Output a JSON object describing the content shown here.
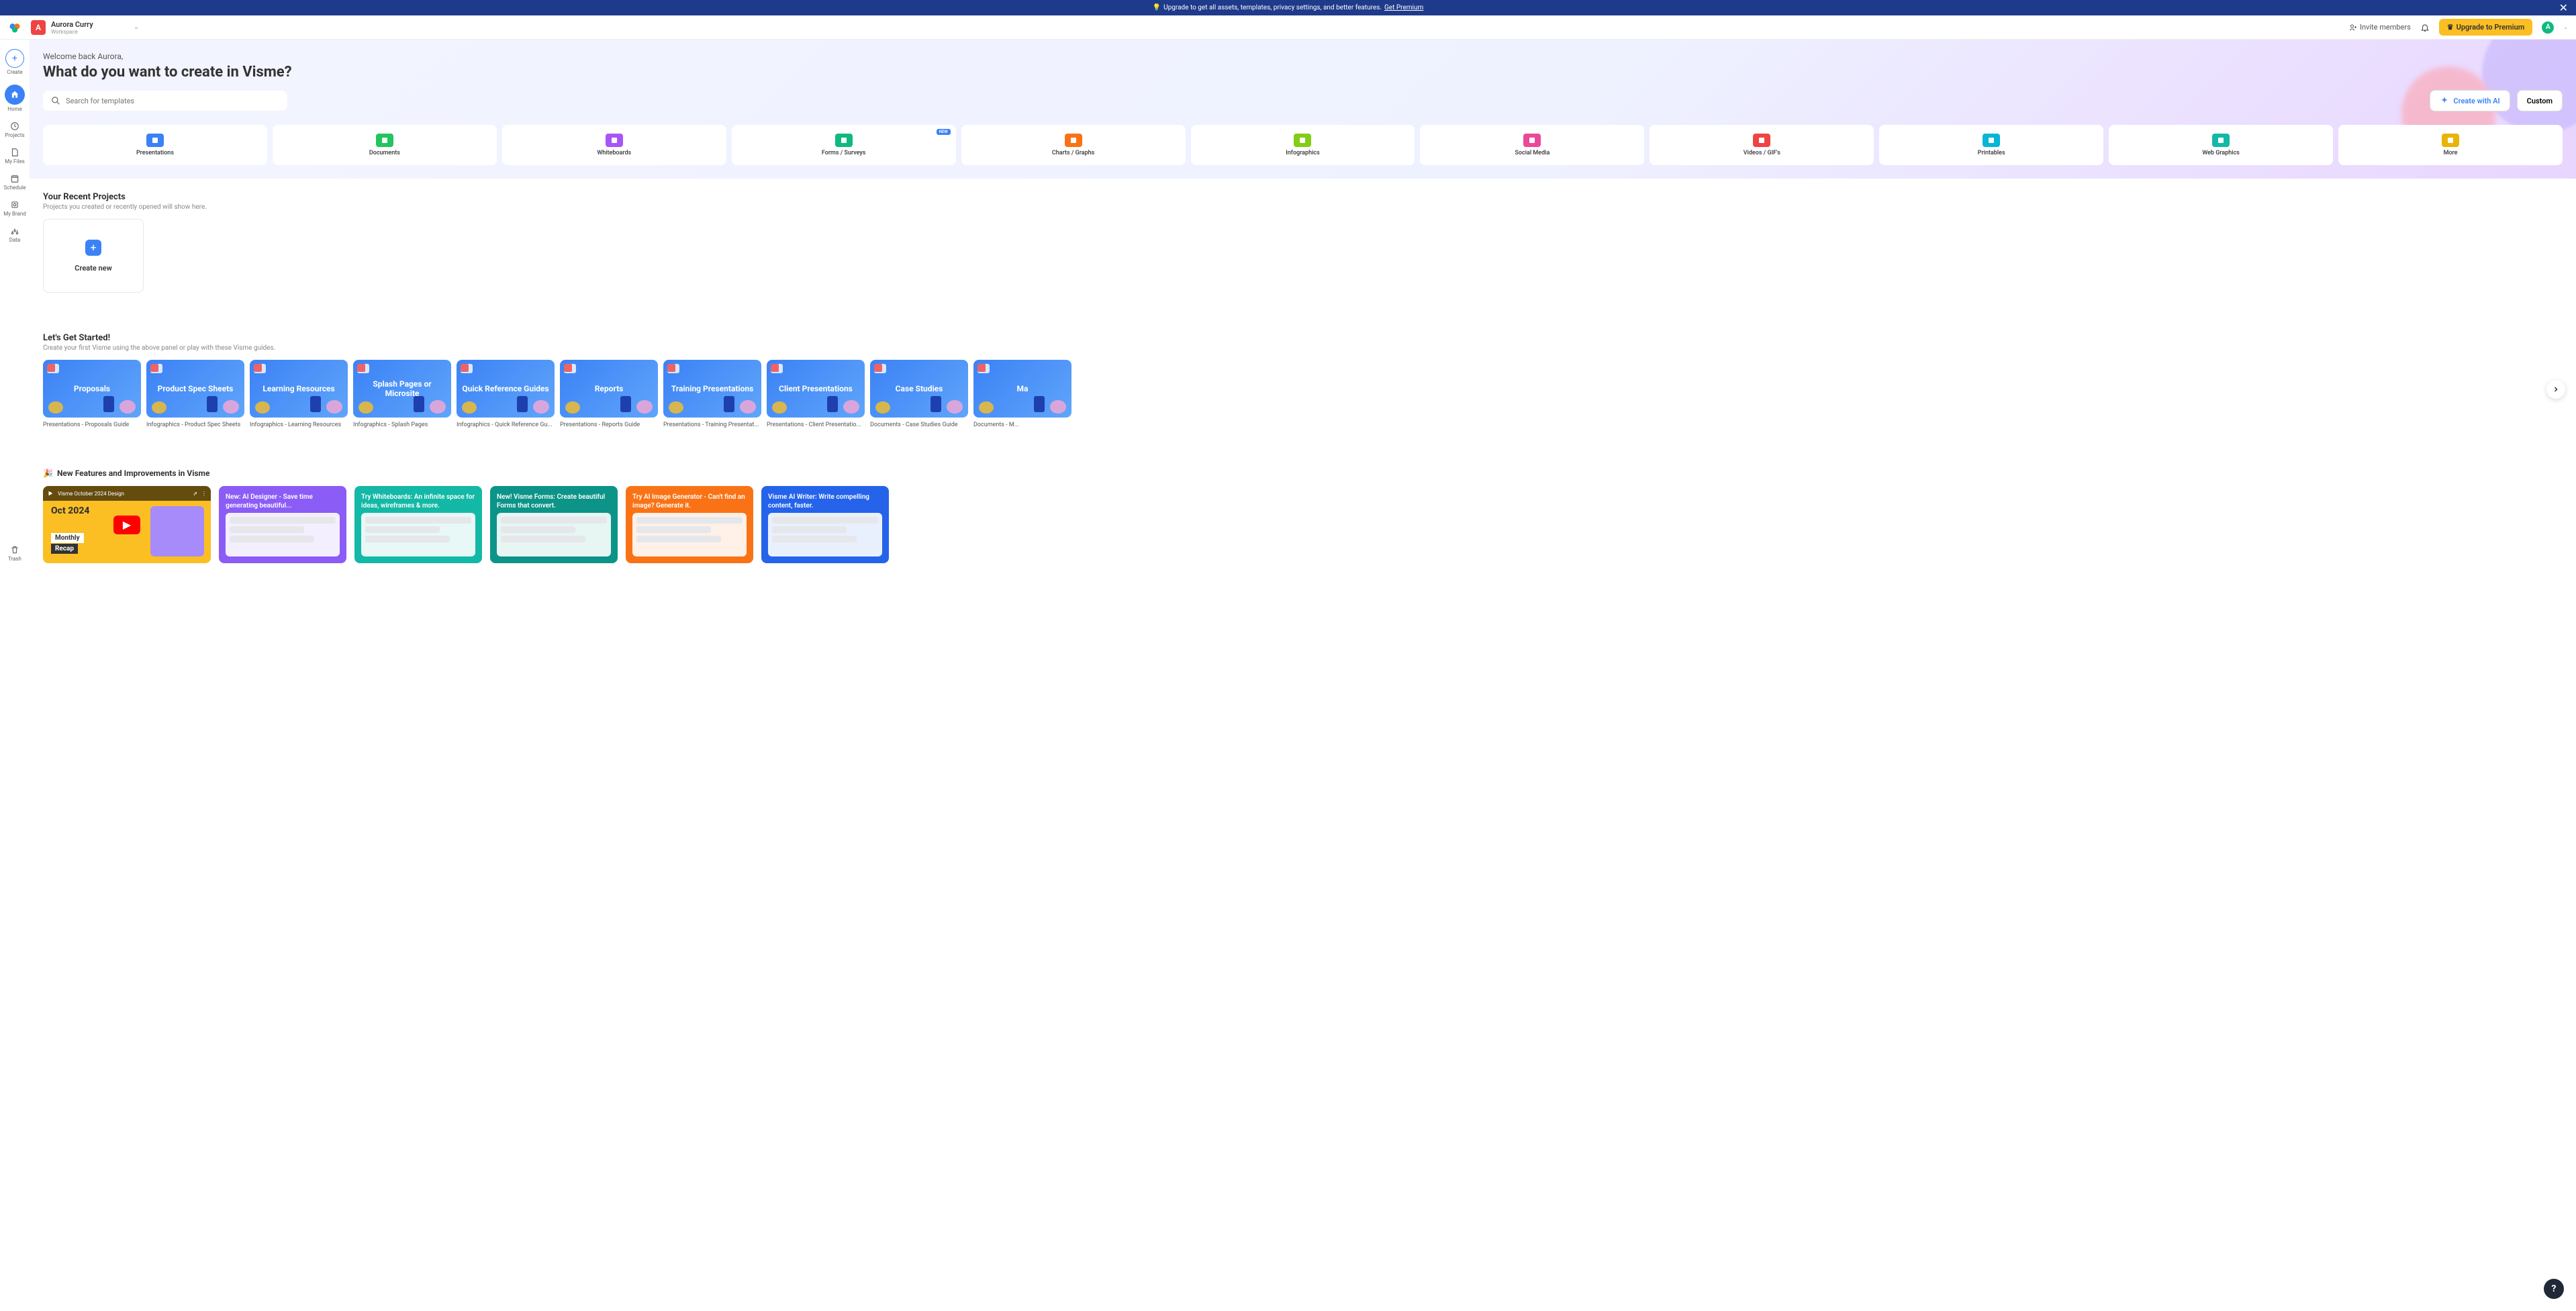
{
  "banner": {
    "icon": "💡",
    "text": "Upgrade to get all assets, templates, privacy settings, and better features.",
    "link": "Get Premium"
  },
  "header": {
    "user_initial": "A",
    "user_name": "Aurora Curry",
    "workspace_label": "Workspace",
    "invite": "Invite members",
    "upgrade": "Upgrade to Premium",
    "avatar_initial": "A"
  },
  "sidebar": {
    "create": "Create",
    "home": "Home",
    "projects": "Projects",
    "my_files": "My Files",
    "schedule": "Schedule",
    "my_brand": "My Brand",
    "data": "Data",
    "trash": "Trash"
  },
  "hero": {
    "welcome": "Welcome back Aurora,",
    "title": "What do you want to create in Visme?",
    "search_placeholder": "Search for templates",
    "create_ai": "Create with AI",
    "custom": "Custom",
    "categories": [
      {
        "label": "Presentations",
        "color": "#3b82f6"
      },
      {
        "label": "Documents",
        "color": "#22c55e"
      },
      {
        "label": "Whiteboards",
        "color": "#a855f7"
      },
      {
        "label": "Forms / Surveys",
        "color": "#10b981",
        "badge": "NEW"
      },
      {
        "label": "Charts / Graphs",
        "color": "#f97316"
      },
      {
        "label": "Infographics",
        "color": "#84cc16"
      },
      {
        "label": "Social Media",
        "color": "#ec4899"
      },
      {
        "label": "Videos / GIF's",
        "color": "#ef4444"
      },
      {
        "label": "Printables",
        "color": "#06b6d4"
      },
      {
        "label": "Web Graphics",
        "color": "#14b8a6"
      },
      {
        "label": "More",
        "color": "#eab308"
      }
    ]
  },
  "recent": {
    "title": "Your Recent Projects",
    "sub": "Projects you created or recently opened will show here.",
    "create_new": "Create new"
  },
  "guides": {
    "title": "Let's Get Started!",
    "sub": "Create your first Visme using the above panel or play with these Visme guides.",
    "items": [
      {
        "thumb": "Proposals",
        "label": "Presentations - Proposals Guide"
      },
      {
        "thumb": "Product Spec Sheets",
        "label": "Infographics - Product Spec Sheets"
      },
      {
        "thumb": "Learning Resources",
        "label": "Infographics - Learning Resources"
      },
      {
        "thumb": "Splash Pages or Microsite",
        "label": "Infographics - Splash Pages"
      },
      {
        "thumb": "Quick Reference Guides",
        "label": "Infographics - Quick Reference Gu..."
      },
      {
        "thumb": "Reports",
        "label": "Presentations - Reports Guide"
      },
      {
        "thumb": "Training Presentations",
        "label": "Presentations - Training Presentat..."
      },
      {
        "thumb": "Client Presentations",
        "label": "Presentations - Client Presentatio..."
      },
      {
        "thumb": "Case Studies",
        "label": "Documents - Case Studies Guide"
      },
      {
        "thumb": "Ma",
        "label": "Documents - M..."
      }
    ]
  },
  "features": {
    "title": "New Features and Improvements in Visme",
    "video_title": "Visme October 2024 Design",
    "video_overlay1": "Oct 2024",
    "video_overlay2": "Monthly",
    "video_overlay3": "Recap",
    "cards": [
      {
        "text": "New: AI Designer - Save time generating beautiful...",
        "color": "#8b5cf6"
      },
      {
        "text": "Try Whiteboards: An infinite space for ideas, wireframes & more.",
        "color": "#14b8a6"
      },
      {
        "text": "New! Visme Forms: Create beautiful Forms that convert.",
        "color": "#0d9488"
      },
      {
        "text": "Try AI Image Generator - Can't find an image? Generate it.",
        "color": "#f97316"
      },
      {
        "text": "Visme AI Writer: Write compelling content, faster.",
        "color": "#2563eb"
      }
    ]
  },
  "help": "?"
}
